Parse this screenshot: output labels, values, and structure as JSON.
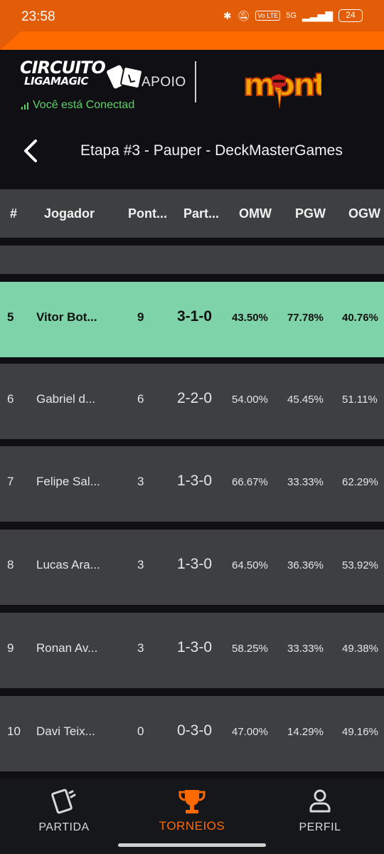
{
  "status_bar": {
    "time": "23:58",
    "network": "5G",
    "volte": "Vo LTE",
    "battery": "24"
  },
  "header": {
    "logo_line1": "CIRCUITO",
    "logo_line2": "LIGAMAGIC",
    "support_label": "APOIO",
    "sponsor_logo": "mont",
    "connection_status": "Você está Conectad"
  },
  "page": {
    "title": "Etapa #3 - Pauper - DeckMasterGames"
  },
  "table": {
    "headers": [
      "#",
      "Jogador",
      "Pont...",
      "Part...",
      "OMW",
      "PGW",
      "OGW"
    ],
    "rows": [
      {
        "rank": "5",
        "player": "Vitor Bot...",
        "points": "9",
        "matches": "3-1-0",
        "omw": "43.50%",
        "pgw": "77.78%",
        "ogw": "40.76%",
        "highlighted": true
      },
      {
        "rank": "6",
        "player": "Gabriel d...",
        "points": "6",
        "matches": "2-2-0",
        "omw": "54.00%",
        "pgw": "45.45%",
        "ogw": "51.11%",
        "highlighted": false
      },
      {
        "rank": "7",
        "player": "Felipe Sal...",
        "points": "3",
        "matches": "1-3-0",
        "omw": "66.67%",
        "pgw": "33.33%",
        "ogw": "62.29%",
        "highlighted": false
      },
      {
        "rank": "8",
        "player": "Lucas Ara...",
        "points": "3",
        "matches": "1-3-0",
        "omw": "64.50%",
        "pgw": "36.36%",
        "ogw": "53.92%",
        "highlighted": false
      },
      {
        "rank": "9",
        "player": "Ronan Av...",
        "points": "3",
        "matches": "1-3-0",
        "omw": "58.25%",
        "pgw": "33.33%",
        "ogw": "49.38%",
        "highlighted": false
      },
      {
        "rank": "10",
        "player": "Davi Teix...",
        "points": "0",
        "matches": "0-3-0",
        "omw": "47.00%",
        "pgw": "14.29%",
        "ogw": "49.16%",
        "highlighted": false
      }
    ]
  },
  "bottom_nav": {
    "items": [
      {
        "label": "PARTIDA",
        "icon": "cards-icon",
        "active": false
      },
      {
        "label": "TORNEIOS",
        "icon": "trophy-icon",
        "active": true
      },
      {
        "label": "PERFIL",
        "icon": "person-icon",
        "active": false
      }
    ]
  },
  "colors": {
    "accent": "#ff6a00",
    "highlight_row": "#7fd3a8",
    "row_bg": "#3e3f40",
    "background": "#101014",
    "connected": "#5fcf6a"
  }
}
